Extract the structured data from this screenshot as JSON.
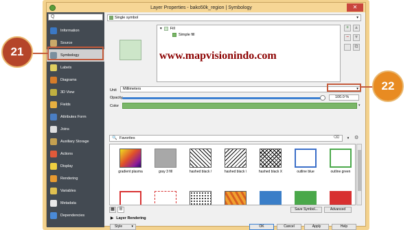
{
  "window": {
    "title": "Layer Properties - bako50k_region | Symbology",
    "close": "✕"
  },
  "sidebar": {
    "search_placeholder": "Q",
    "items": [
      {
        "label": "Information",
        "icon": "information-icon",
        "color": "#3b78c4"
      },
      {
        "label": "Source",
        "icon": "source-icon",
        "color": "#c9a96a"
      },
      {
        "label": "Symbology",
        "icon": "symbology-icon",
        "color": "#7a8f9e"
      },
      {
        "label": "Labels",
        "icon": "labels-icon",
        "color": "#e0d060"
      },
      {
        "label": "Diagrams",
        "icon": "diagrams-icon",
        "color": "#d67c2a"
      },
      {
        "label": "3D View",
        "icon": "3d-view-icon",
        "color": "#c0b040"
      },
      {
        "label": "Fields",
        "icon": "fields-icon",
        "color": "#e8b040"
      },
      {
        "label": "Attributes Form",
        "icon": "attributes-form-icon",
        "color": "#4a7ec4"
      },
      {
        "label": "Joins",
        "icon": "joins-icon",
        "color": "#e0e0e0"
      },
      {
        "label": "Auxiliary Storage",
        "icon": "auxiliary-storage-icon",
        "color": "#c4a050"
      },
      {
        "label": "Actions",
        "icon": "actions-icon",
        "color": "#e05a3a"
      },
      {
        "label": "Display",
        "icon": "display-icon",
        "color": "#f0d040"
      },
      {
        "label": "Rendering",
        "icon": "rendering-icon",
        "color": "#e89a30"
      },
      {
        "label": "Variables",
        "icon": "variables-icon",
        "color": "#e0c050"
      },
      {
        "label": "Metadata",
        "icon": "metadata-icon",
        "color": "#e8e8e8"
      },
      {
        "label": "Dependencies",
        "icon": "dependencies-icon",
        "color": "#4a8ad8"
      }
    ]
  },
  "renderer": {
    "selected": "Single symbol",
    "arrow": "▾"
  },
  "symbol_tree": {
    "fill_label": "Fill",
    "simple_fill_label": "Simple fill",
    "toggle": "▾"
  },
  "watermark": "www.mapvisionindo.com",
  "tool_buttons": {
    "add": "+",
    "remove": "−",
    "up": "▲",
    "down": "▼",
    "lock": "🔒",
    "dup": "⧉"
  },
  "unit": {
    "label": "Unit",
    "value": "Millimeters",
    "arrow": "▾"
  },
  "opacity": {
    "label": "Opacity",
    "value": "100.0 %",
    "percent": 100
  },
  "color": {
    "label": "Color",
    "value": "#7ab668"
  },
  "favorites": {
    "search_value": "Favorites",
    "mag": "🔍",
    "clear": "⌫",
    "arrow": "▾",
    "gear": "⚙"
  },
  "symbols": [
    {
      "label": "gradient plasma",
      "style": "gradient"
    },
    {
      "label": "gray 3 fill",
      "style": "gray"
    },
    {
      "label": "hashed black /",
      "style": "hash1"
    },
    {
      "label": "hashed black \\",
      "style": "hash2"
    },
    {
      "label": "hashed black X",
      "style": "hashx"
    },
    {
      "label": "outline blue",
      "style": "outblue"
    },
    {
      "label": "outline green",
      "style": "outgreen"
    }
  ],
  "symbols_row2": [
    {
      "style": "outred"
    },
    {
      "style": "dotline"
    },
    {
      "style": "dots"
    },
    {
      "style": "tri"
    },
    {
      "style": "blue"
    },
    {
      "style": "green"
    },
    {
      "style": "red"
    }
  ],
  "buttons": {
    "save_symbol": "Save Symbol...",
    "advanced": "Advanced",
    "layer_rendering": "Layer Rendering",
    "style": "Style",
    "ok": "OK",
    "cancel": "Cancel",
    "apply": "Apply",
    "help": "Help",
    "expand": "▶",
    "arrow": "▾"
  },
  "callouts": {
    "a": "21",
    "b": "22"
  }
}
